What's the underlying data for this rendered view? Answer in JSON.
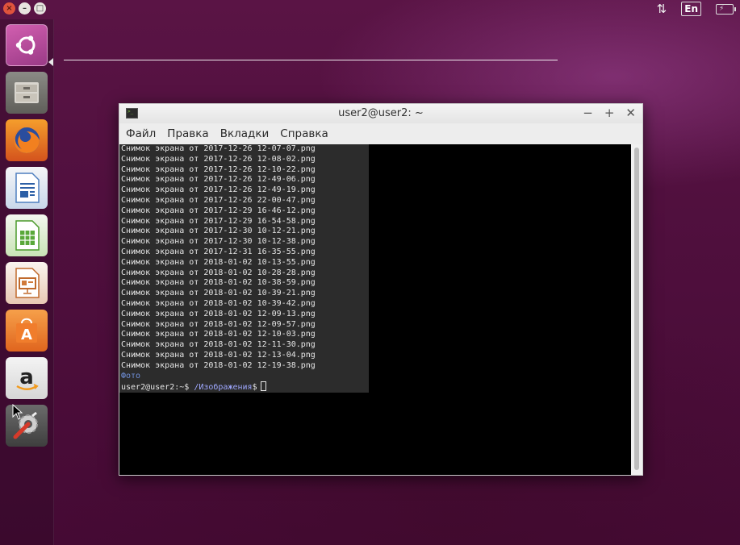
{
  "top_panel": {
    "window_controls": [
      "close-icon",
      "minimize-icon",
      "maximize-icon"
    ],
    "tray": {
      "network_icon": "network-updown-icon",
      "language": "En",
      "battery_icon": "battery-charging-icon"
    }
  },
  "launcher": {
    "items": [
      {
        "name": "ubuntu-dash",
        "icon": "ubuntu-logo-icon"
      },
      {
        "name": "files",
        "icon": "file-cabinet-icon"
      },
      {
        "name": "firefox",
        "icon": "firefox-icon"
      },
      {
        "name": "libreoffice-writer",
        "icon": "writer-icon"
      },
      {
        "name": "libreoffice-calc",
        "icon": "calc-icon"
      },
      {
        "name": "libreoffice-impress",
        "icon": "impress-icon"
      },
      {
        "name": "ubuntu-software",
        "icon": "store-bag-icon"
      },
      {
        "name": "amazon",
        "icon": "amazon-icon"
      },
      {
        "name": "system-settings",
        "icon": "wrench-gear-icon"
      }
    ]
  },
  "terminal": {
    "title": "user2@user2: ~",
    "menu": [
      "Файл",
      "Правка",
      "Вкладки",
      "Справка"
    ],
    "lines": [
      "Снимок экрана от 2017-12-26 12-07-07.png",
      "Снимок экрана от 2017-12-26 12-08-02.png",
      "Снимок экрана от 2017-12-26 12-10-22.png",
      "Снимок экрана от 2017-12-26 12-49-06.png",
      "Снимок экрана от 2017-12-26 12-49-19.png",
      "Снимок экрана от 2017-12-26 22-00-47.png",
      "Снимок экрана от 2017-12-29 16-46-12.png",
      "Снимок экрана от 2017-12-29 16-54-58.png",
      "Снимок экрана от 2017-12-30 10-12-21.png",
      "Снимок экрана от 2017-12-30 10-12-38.png",
      "Снимок экрана от 2017-12-31 16-35-55.png",
      "Снимок экрана от 2018-01-02 10-13-55.png",
      "Снимок экрана от 2018-01-02 10-28-28.png",
      "Снимок экрана от 2018-01-02 10-38-59.png",
      "Снимок экрана от 2018-01-02 10-39-21.png",
      "Снимок экрана от 2018-01-02 10-39-42.png",
      "Снимок экрана от 2018-01-02 12-09-13.png",
      "Снимок экрана от 2018-01-02 12-09-57.png",
      "Снимок экрана от 2018-01-02 12-10-03.png",
      "Снимок экрана от 2018-01-02 12-11-30.png",
      "Снимок экрана от 2018-01-02 12-13-04.png",
      "Снимок экрана от 2018-01-02 12-19-38.png"
    ],
    "folder_entry": "Фото",
    "prompt": "user2@user2:~$ ",
    "prompt_path": "/Изображения",
    "prompt_suffix": "$"
  }
}
